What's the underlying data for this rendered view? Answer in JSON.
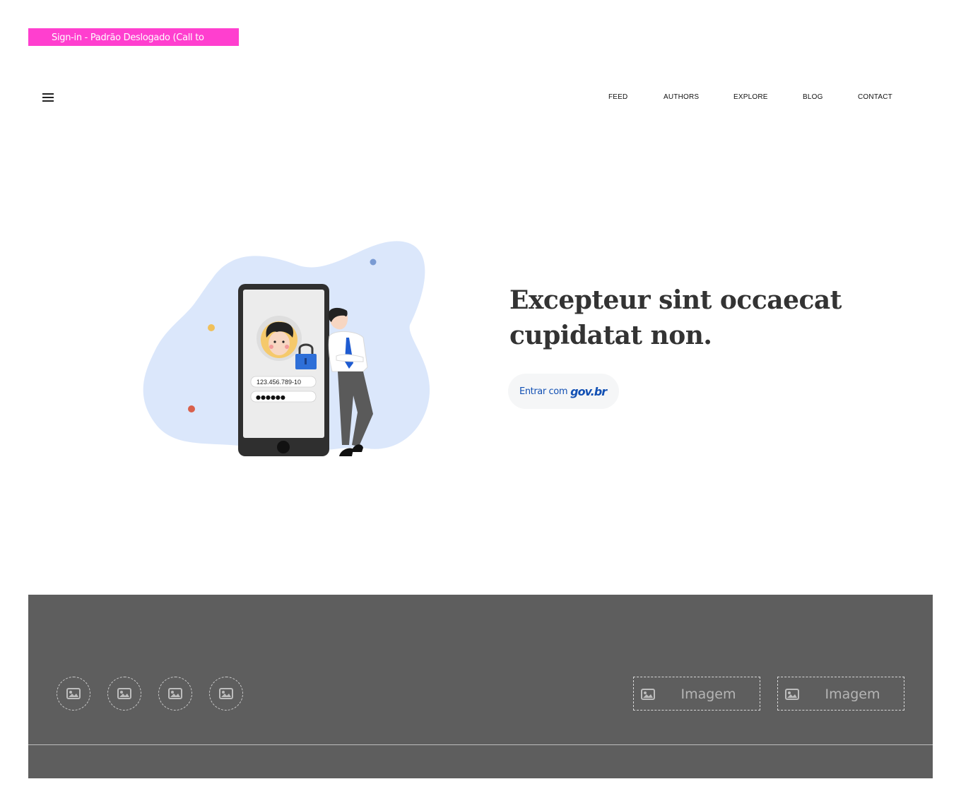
{
  "page_label": "Sign-in - Padrão Deslogado (Call to",
  "header": {
    "menu_icon": "hamburger-menu-icon",
    "nav": [
      {
        "label": "FEED"
      },
      {
        "label": "AUTHORS"
      },
      {
        "label": "EXPLORE"
      },
      {
        "label": "BLOG"
      },
      {
        "label": "CONTACT"
      }
    ]
  },
  "hero": {
    "title": "Excepteur sint occaecat cupidatat non.",
    "illustration": {
      "cpf_text": "123.456.789-10",
      "password_text": "●●●●●●"
    },
    "login_button": {
      "label": "Entrar com",
      "logo": "gov.br"
    }
  },
  "footer": {
    "social_icons": [
      "image-placeholder-icon",
      "image-placeholder-icon",
      "image-placeholder-icon",
      "image-placeholder-icon"
    ],
    "image_boxes": [
      {
        "label": "Imagem"
      },
      {
        "label": "Imagem"
      }
    ]
  },
  "colors": {
    "page_label_bg": "#ff3fcf",
    "govbr_blue": "#1351b4",
    "footer_bg": "#5e5e5e",
    "blob": "#dbe7fb"
  }
}
